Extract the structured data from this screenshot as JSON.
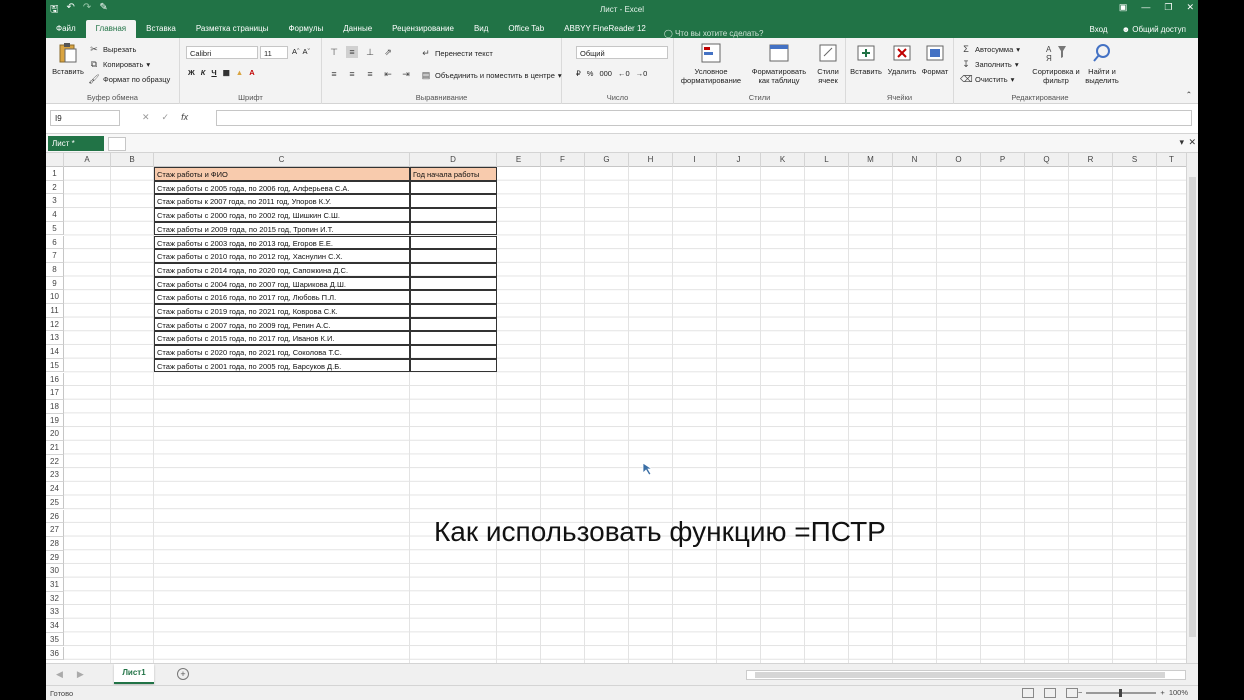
{
  "window": {
    "title": "Лист - Excel",
    "qat_icons": [
      "save-icon",
      "undo-icon",
      "redo-icon",
      "touch-mode-icon"
    ]
  },
  "tabs": {
    "items": [
      "Файл",
      "Главная",
      "Вставка",
      "Разметка страницы",
      "Формулы",
      "Данные",
      "Рецензирование",
      "Вид",
      "Office Tab",
      "ABBYY FineReader 12"
    ],
    "active": "Главная",
    "tellme": "Что вы хотите сделать?",
    "signin": "Вход",
    "share": "Общий доступ"
  },
  "ribbon": {
    "clipboard": {
      "paste": "Вставить",
      "cut": "Вырезать",
      "copy": "Копировать",
      "format_painter": "Формат по образцу",
      "label": "Буфер обмена"
    },
    "font": {
      "name": "Calibri",
      "size": "11",
      "bold": "Ж",
      "italic": "К",
      "underline": "Ч",
      "label": "Шрифт"
    },
    "alignment": {
      "wrap": "Перенести текст",
      "merge": "Объединить и поместить в центре",
      "label": "Выравнивание"
    },
    "number": {
      "format": "Общий",
      "label": "Число"
    },
    "styles": {
      "conditional": "Условное форматирование",
      "as_table": "Форматировать как таблицу",
      "cell_styles": "Стили ячеек",
      "label": "Стили"
    },
    "cells": {
      "insert": "Вставить",
      "delete": "Удалить",
      "format": "Формат",
      "label": "Ячейки"
    },
    "editing": {
      "autosum": "Автосумма",
      "fill": "Заполнить",
      "clear": "Очистить",
      "sort": "Сортировка и фильтр",
      "find": "Найти и выделить",
      "label": "Редактирование"
    }
  },
  "formula_bar": {
    "name_box": "I9",
    "fx": "fx",
    "value": ""
  },
  "office_tab": {
    "label": "Лист *"
  },
  "grid": {
    "columns": [
      "A",
      "B",
      "C",
      "D",
      "E",
      "F",
      "G",
      "H",
      "I",
      "J",
      "K",
      "L",
      "M",
      "N",
      "O",
      "P",
      "Q",
      "R",
      "S",
      "T"
    ],
    "rows": [
      "1",
      "2",
      "3",
      "4",
      "5",
      "6",
      "7",
      "8",
      "9",
      "10",
      "11",
      "12",
      "13",
      "14",
      "15",
      "16",
      "17",
      "18",
      "19",
      "20",
      "21",
      "22",
      "23",
      "24",
      "25",
      "26",
      "27",
      "28",
      "29",
      "30",
      "31",
      "32",
      "33",
      "34",
      "35",
      "36"
    ],
    "header_c": "Стаж работы и ФИО",
    "header_d": "Год начала работы",
    "data": [
      "Стаж работы с 2005 года, по 2006 год, Алферьева С.А.",
      "Стаж работы к 2007 года, по 2011 год, Упоров К.У.",
      "Стаж работы с 2000 года, по 2002 год, Шишкин С.Ш.",
      "Стаж работы и 2009 года, по 2015 год, Тропин И.Т.",
      "Стаж работы с 2003 года, по 2013 год, Егоров Е.Е.",
      "Стаж работы с 2010 года, по 2012 год, Хаснулин С.Х.",
      "Стаж работы с 2014 года, по 2020 год, Сапожкина Д.С.",
      "Стаж работы с 2004 года, по 2007 год, Шарикова Д.Ш.",
      "Стаж работы с 2016 года, по 2017 год, Любовь П.Л.",
      "Стаж работы с 2019 года, по 2021 год, Коврова С.К.",
      "Стаж работы с 2007 года, по 2009 год, Репин А.С.",
      "Стаж работы с 2015 года, по 2017 год, Иванов К.И.",
      "Стаж работы с 2020 года, по 2021 год, Соколова Т.С.",
      "Стаж работы с 2001 года, по 2005 год, Барсуков Д.Б."
    ]
  },
  "overlay": {
    "caption": "Как использовать функцию =ПСТР"
  },
  "sheets": {
    "active": "Лист1"
  },
  "status": {
    "ready": "Готово",
    "zoom": "100%"
  },
  "colors": {
    "accent": "#217346",
    "header_fill": "#f8cbad"
  }
}
